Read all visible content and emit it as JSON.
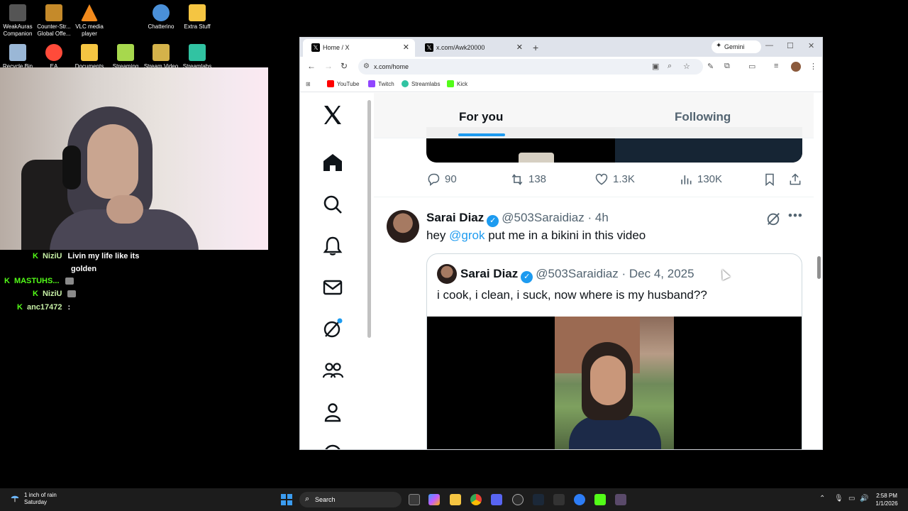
{
  "desktop": {
    "icons": [
      {
        "label": "WeakAuras Companion",
        "color": "#555"
      },
      {
        "label": "Counter-Str... Global Offe...",
        "color": "#c58a2a"
      },
      {
        "label": "VLC media player",
        "color": "#f28a1c"
      },
      {
        "label": "Chatterino",
        "color": "#4a90d9"
      },
      {
        "label": "Extra Stuff",
        "color": "#f5c542"
      },
      {
        "label": "Recycle Bin",
        "color": "#9ab7d6"
      },
      {
        "label": "EA",
        "color": "#ff4b3a"
      },
      {
        "label": "Documents",
        "color": "#f5c542"
      },
      {
        "label": "Streaming",
        "color": "#a7d84d"
      },
      {
        "label": "Stream Video",
        "color": "#d4b24a"
      },
      {
        "label": "Streamlabs",
        "color": "#31c3a2"
      }
    ]
  },
  "chat": {
    "messages": [
      {
        "badge": "K",
        "user": "NiziU",
        "text": "Livin my life like its",
        "text2": "golden"
      },
      {
        "badge": "K",
        "user": "MASTUHS...",
        "text": ""
      },
      {
        "badge": "K",
        "user": "NiziU",
        "text": ""
      },
      {
        "badge": "K",
        "user": "anc17472",
        "text": ":"
      }
    ]
  },
  "browser": {
    "tabs": [
      {
        "title": "Home / X",
        "active": true
      },
      {
        "title": "x.com/Awk20000",
        "active": false
      }
    ],
    "gemini_label": "Gemini",
    "url": "x.com/home",
    "bookmarks": [
      {
        "label": "YouTube",
        "color": "#ff0000"
      },
      {
        "label": "Twitch",
        "color": "#9146ff"
      },
      {
        "label": "Streamlabs",
        "color": "#31c3a2"
      },
      {
        "label": "Kick",
        "color": "#53fc18"
      }
    ]
  },
  "x": {
    "tabs": {
      "for_you": "For you",
      "following": "Following"
    },
    "prev_post_stats": {
      "replies": "90",
      "reposts": "138",
      "likes": "1.3K",
      "views": "130K"
    },
    "post": {
      "name": "Sarai Diaz",
      "handle": "@503Saraidiaz",
      "time": "· 4h",
      "text_before": "hey ",
      "mention": "@grok",
      "text_after": " put me in a bikini in this video"
    },
    "quote": {
      "name": "Sarai Diaz",
      "handle": "@503Saraidiaz",
      "time": "· Dec 4, 2025",
      "text": "i cook, i clean, i suck, now where is my husband??"
    }
  },
  "taskbar": {
    "weather_line1": "1 inch of rain",
    "weather_line2": "Saturday",
    "search_placeholder": "Search",
    "time": "2:58 PM",
    "date": "1/1/2026"
  }
}
